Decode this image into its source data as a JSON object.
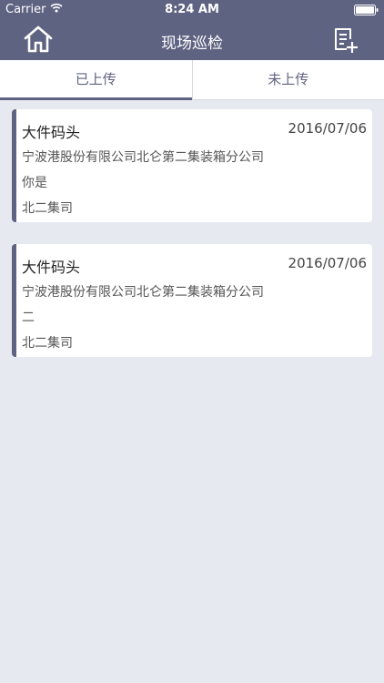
{
  "status_bar": {
    "carrier": "Carrier",
    "time": "8:24 AM",
    "icons": [
      "wifi-icon",
      "battery-icon"
    ]
  },
  "nav": {
    "title": "现场巡检",
    "left_icon": "home-icon",
    "right_icon": "add-record-icon"
  },
  "tabs": [
    {
      "label": "已上传",
      "active": true
    },
    {
      "label": "未上传",
      "active": false
    }
  ],
  "records": [
    {
      "title": "大件码头",
      "date": "2016/07/06",
      "company": "宁波港股份有限公司北仑第二集装箱分公司",
      "note": "你是",
      "dept": "北二集司"
    },
    {
      "title": "大件码头",
      "date": "2016/07/06",
      "company": "宁波港股份有限公司北仑第二集装箱分公司",
      "note": "二",
      "dept": "北二集司"
    }
  ],
  "colors": {
    "accent": "#5f6382",
    "background": "#e6e9f0",
    "card": "#ffffff"
  }
}
